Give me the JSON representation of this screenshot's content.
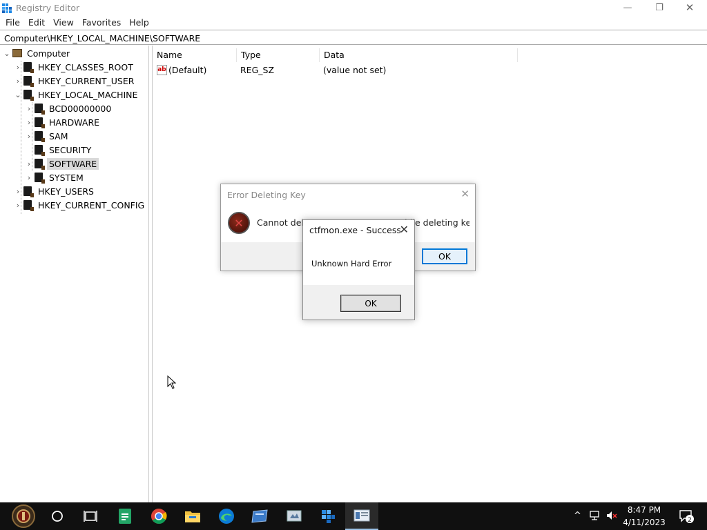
{
  "window": {
    "title": "Registry Editor",
    "minimize_glyph": "—",
    "restore_glyph": "❐",
    "close_glyph": "✕"
  },
  "menu": [
    "File",
    "Edit",
    "View",
    "Favorites",
    "Help"
  ],
  "address": "Computer\\HKEY_LOCAL_MACHINE\\SOFTWARE",
  "tree": {
    "root": "Computer",
    "items": [
      {
        "label": "HKEY_CLASSES_ROOT",
        "expanded": false
      },
      {
        "label": "HKEY_CURRENT_USER",
        "expanded": false
      },
      {
        "label": "HKEY_LOCAL_MACHINE",
        "expanded": true
      },
      {
        "label": "BCD00000000",
        "expanded": false
      },
      {
        "label": "HARDWARE",
        "expanded": false
      },
      {
        "label": "SAM",
        "expanded": false
      },
      {
        "label": "SECURITY",
        "expanded": false
      },
      {
        "label": "SOFTWARE",
        "expanded": false,
        "selected": true
      },
      {
        "label": "SYSTEM",
        "expanded": false
      },
      {
        "label": "HKEY_USERS",
        "expanded": false
      },
      {
        "label": "HKEY_CURRENT_CONFIG",
        "expanded": false
      }
    ]
  },
  "values": {
    "columns": [
      "Name",
      "Type",
      "Data"
    ],
    "rows": [
      {
        "name": "(Default)",
        "type": "REG_SZ",
        "data": "(value not set)",
        "icon": "ab"
      }
    ]
  },
  "error_dialog": {
    "title": "Error Deleting Key",
    "message": "Cannot delete SOFTWARE: Error while deleting key.",
    "ok": "OK",
    "icon": "error-icon"
  },
  "success_dialog": {
    "title": "ctfmon.exe - Success",
    "message": "Unknown Hard Error",
    "ok": "OK"
  },
  "taskbar": {
    "time": "8:47 PM",
    "date": "4/11/2023",
    "notification_count": "2",
    "icons": [
      "start-icon",
      "cortana-icon",
      "task-view-icon",
      "sheets-icon",
      "chrome-icon",
      "file-explorer-icon",
      "edge-icon",
      "app-icon-1",
      "app-icon-2",
      "app-icon-3",
      "registry-editor-icon"
    ]
  },
  "colors": {
    "selection": "#d9d9d9",
    "accent": "#0078d7",
    "taskbar": "#101010"
  }
}
